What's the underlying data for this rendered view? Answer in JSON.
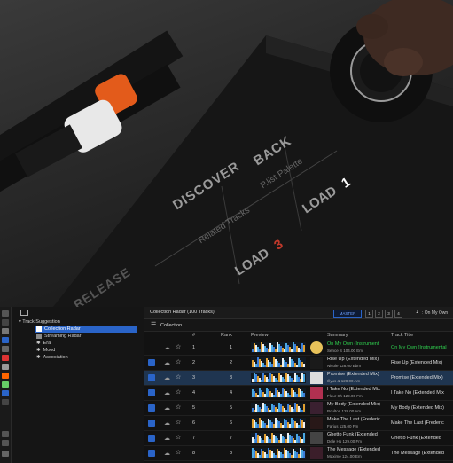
{
  "photo": {
    "labels": {
      "discover": "DISCOVER",
      "related": "Related Tracks",
      "back": "BACK",
      "palette": "P.list Palette",
      "load1": "LOAD",
      "load1_num": "1",
      "load3": "LOAD",
      "load3_num": "3",
      "release": "RELEASE"
    }
  },
  "tree": {
    "root": "Track Suggestion",
    "items": [
      "Collection Radar",
      "Streaming Radar",
      "Era",
      "Mood",
      "Association"
    ],
    "selected": "Collection Radar"
  },
  "main": {
    "title": "Collection Radar (100 Tracks)",
    "master_label": "MASTER",
    "deck_buttons": [
      "1",
      "2",
      "3",
      "4"
    ],
    "now_playing": "On My Own",
    "crumb": "Collection",
    "columns": {
      "num": "#",
      "rank": "Rank",
      "preview": "Preview",
      "summary": "Summary",
      "track_title": "Track Title"
    },
    "rows": [
      {
        "num": "1",
        "rank": "1",
        "sum1": "On My Own (Instrument",
        "sum2": "Sence S 104.00 Em",
        "title": "On My Own (Instrumental",
        "green": true
      },
      {
        "num": "2",
        "rank": "2",
        "sum1": "Rise Up (Extended Mix)",
        "sum2": "Nicole 128.00 Ebm",
        "title": "Rise Up (Extended Mix)"
      },
      {
        "num": "3",
        "rank": "3",
        "sum1": "Promise (Extended Mix)",
        "sum2": "Illyus & 128.00 Am",
        "title": "Promise (Extended Mix)"
      },
      {
        "num": "4",
        "rank": "4",
        "sum1": "I Take No (Extended Mix",
        "sum2": "Fleur Sh 129.00 Fm",
        "title": "I Take No (Extended Mix"
      },
      {
        "num": "5",
        "rank": "5",
        "sum1": "My Body (Extended Mix)",
        "sum2": "Poulton 128.00 Am",
        "title": "My Body (Extended Mix)"
      },
      {
        "num": "6",
        "rank": "6",
        "sum1": "Make The Last (Frederic",
        "sum2": "Farius 125.00 Fm",
        "title": "Make The Last (Frederic"
      },
      {
        "num": "7",
        "rank": "7",
        "sum1": "Ghetto Funk (Extended",
        "sum2": "Dele Ho 129.00 Fm",
        "title": "Ghetto Funk (Extended"
      },
      {
        "num": "8",
        "rank": "8",
        "sum1": "The Message (Extended",
        "sum2": "Maxime 124.00 Em",
        "title": "The Message (Extended"
      }
    ]
  },
  "colors": {
    "accent_blue": "#2a64c8",
    "green_text": "#2fd14f",
    "orange_cable": "#e35b1b",
    "load3_red": "#c0392b"
  }
}
